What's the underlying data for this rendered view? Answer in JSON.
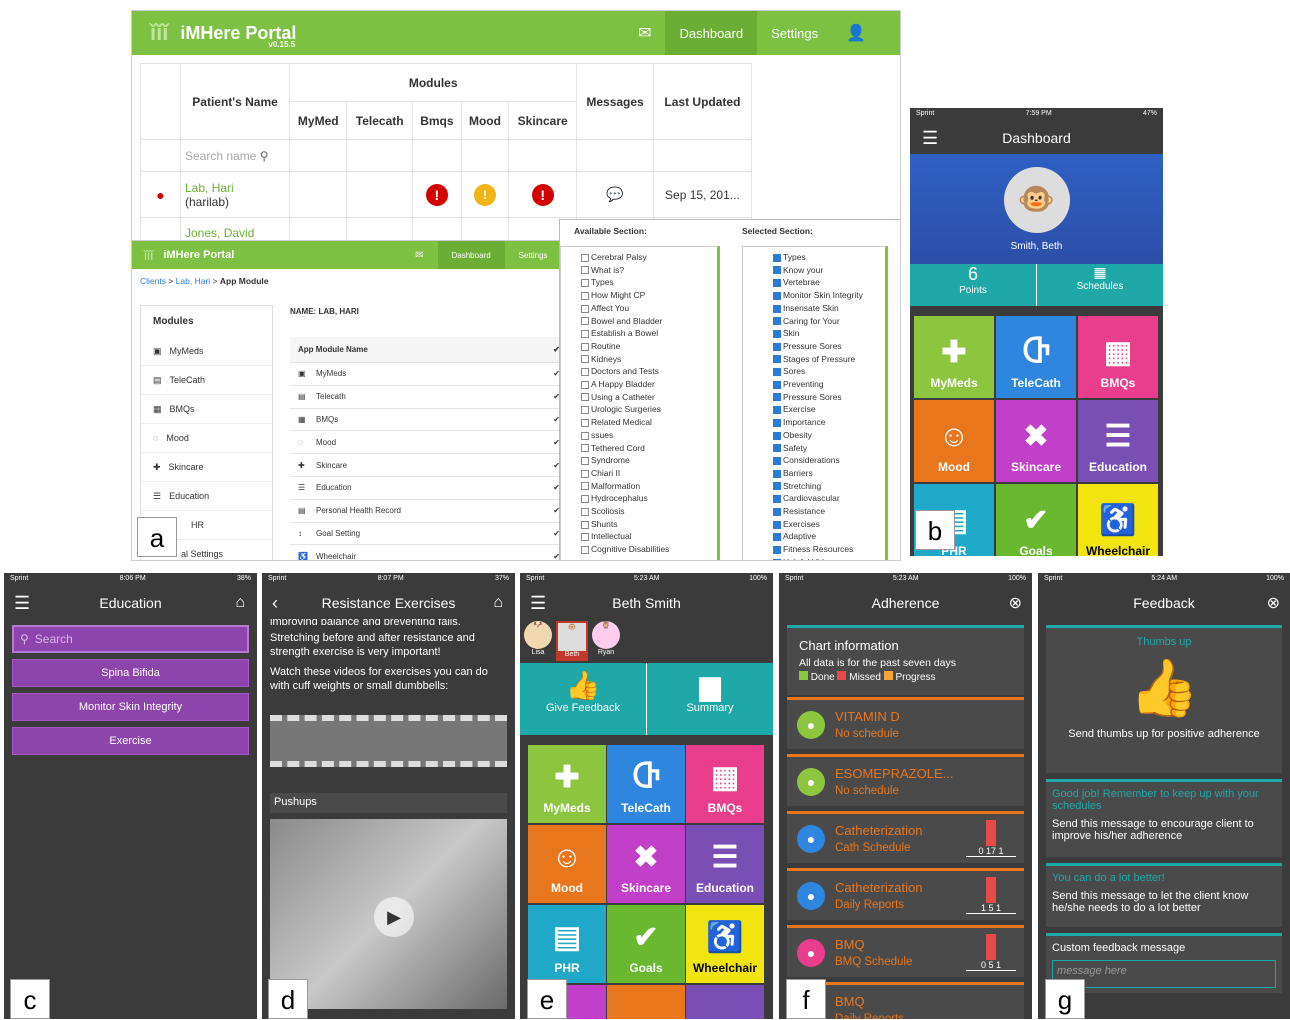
{
  "labels": {
    "a": "a",
    "b": "b",
    "c": "c",
    "d": "d",
    "e": "e",
    "f": "f",
    "g": "g"
  },
  "portal": {
    "title": "iMHere Portal",
    "version": "v0.15.5",
    "nav": [
      "Dashboard",
      "Settings"
    ],
    "headers": {
      "name": "Patient's Name",
      "modules": "Modules",
      "messages": "Messages",
      "updated": "Last Updated",
      "cols": [
        "MyMed",
        "Telecath",
        "Bmqs",
        "Mood",
        "Skincare"
      ]
    },
    "search_placeholder": "Search name",
    "rows": [
      {
        "name": "Lab, Hari",
        "user": "(harilab)",
        "date": "Sep 15, 201..."
      },
      {
        "name": "Jones, David"
      }
    ]
  },
  "inner": {
    "title": "iMHere Portal",
    "nav": [
      "Dashboard",
      "Settings"
    ],
    "crumbs": [
      "Clients",
      "Lab, Hari",
      "App Module"
    ],
    "modules_head": "Modules",
    "name_label": "NAME: LAB, HARI",
    "table_head": "App Module Name",
    "modules": [
      "MyMeds",
      "TeleCath",
      "BMQs",
      "Mood",
      "Skincare",
      "Education",
      "HR",
      "al Settings"
    ],
    "apps": [
      "MyMeds",
      "Telecath",
      "BMQs",
      "Mood",
      "Skincare",
      "Education",
      "Personal Health Record",
      "Goal Setting",
      "Wheelchair"
    ]
  },
  "sections": {
    "avail_head": "Available Section:",
    "sel_head": "Selected Section:",
    "avail": [
      "Cerebral Palsy",
      "What is?",
      "Types",
      "How Might CP",
      "Affect You",
      "Bowel and Bladder",
      "Establish a Bowel",
      "Routine",
      "Kidneys",
      "Doctors and Tests",
      "A Happy Bladder",
      "Using a Catheter",
      "Urologic Surgeries",
      "Related Medical",
      "ssues",
      "Tethered Cord",
      "Syndrome",
      "Chiari II",
      "Malformation",
      "Hydrocephalus",
      "Scoliosis",
      "Shunts",
      "Intellectual",
      "Cognitive Disabilities"
    ],
    "sel": [
      "Types",
      "Know your",
      "Vertebrae",
      "Monitor Skin Integrity",
      "Insensate Skin",
      "Caring for Your",
      "Skin",
      "Pressure Sores",
      "Stages of Pressure",
      "Sores",
      "Preventing",
      "Pressure Sores",
      "Exercise",
      "Importance",
      "Obesity",
      "Safety",
      "Considerations",
      "Barriers",
      "Stretching",
      "Cardiovascular",
      "Resistance",
      "Exercises",
      "Adaptive",
      "Fitness Resources",
      "Helpful Videos"
    ]
  },
  "b": {
    "status": [
      "Sprint",
      "7:59 PM",
      "47%"
    ],
    "title": "Dashboard",
    "user": "Smith, Beth",
    "points": "6",
    "points_label": "Points",
    "schedules": "Schedules",
    "tiles": [
      "MyMeds",
      "TeleCath",
      "BMQs",
      "Mood",
      "Skincare",
      "Education",
      "PHR",
      "Goals",
      "Wheelchair"
    ]
  },
  "c": {
    "status": [
      "Sprint",
      "8:06 PM",
      "38%"
    ],
    "title": "Education",
    "search": "Search",
    "items": [
      "Spina Bifida",
      "Monitor Skin Integrity",
      "Exercise"
    ]
  },
  "d": {
    "status": [
      "Sprint",
      "8:07 PM",
      "37%"
    ],
    "title": "Resistance Exercises",
    "p0": "improving balance and preventing falls.",
    "p1": "Stretching before and after resistance and strength exercise is very important!",
    "p2": "Watch these videos for exercises you can do with cuff weights or small dumbbells:",
    "video": "Pushups"
  },
  "e": {
    "status": [
      "Sprint",
      "5:23 AM",
      "100%"
    ],
    "title": "Beth Smith",
    "avatars": [
      "Lisa",
      "Beth",
      "Ryan"
    ],
    "feedback": "Give Feedback",
    "summary": "Summary",
    "tiles": [
      "MyMeds",
      "TeleCath",
      "BMQs",
      "Mood",
      "Skincare",
      "Education",
      "PHR",
      "Goals",
      "Wheelchair"
    ]
  },
  "f": {
    "status": [
      "Sprint",
      "5:23 AM",
      "100%"
    ],
    "title": "Adherence",
    "info_title": "Chart information",
    "info_text": "All data is for the past seven days",
    "legend": [
      "Done",
      "Missed",
      "Progress"
    ],
    "rows": [
      {
        "t": "VITAMIN D",
        "s": "No schedule"
      },
      {
        "t": "ESOMEPRAZOLE...",
        "s": "No schedule"
      },
      {
        "t": "Catheterization",
        "s": "Cath Schedule",
        "n": "0 17 1"
      },
      {
        "t": "Catheterization",
        "s": "Daily Reports",
        "n": "1 5 1"
      },
      {
        "t": "BMQ",
        "s": "BMQ Schedule",
        "n": "0 5 1"
      },
      {
        "t": "BMQ",
        "s": "Daily Reports"
      }
    ]
  },
  "g": {
    "status": [
      "Sprint",
      "5:24 AM",
      "100%"
    ],
    "title": "Feedback",
    "thumbs": "Thumbs up",
    "thumbs_desc": "Send thumbs up for positive adherence",
    "msg1": "Good job! Remember to keep up with your schedules",
    "msg1_desc": "Send this message to encourage client to improve his/her adherence",
    "msg2": "You can do a lot better!",
    "msg2_desc": "Send this message to let the client know he/she needs to do a lot better",
    "custom": "Custom feedback message",
    "placeholder": "message here"
  },
  "colors": {
    "green": "#7dc143",
    "teal": "#1fa8a8",
    "purple": "#8e44ad",
    "orange": "#e8761c"
  }
}
